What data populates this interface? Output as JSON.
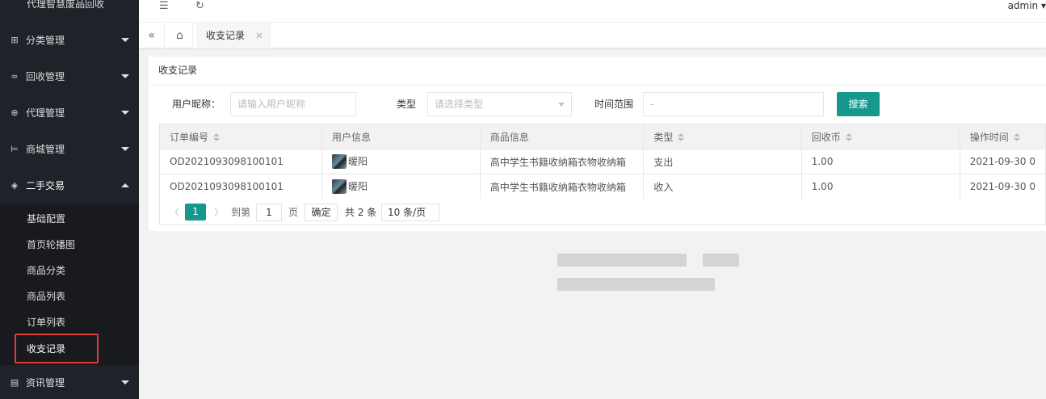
{
  "sidebar": {
    "top_partial": "代理智慧废品回收",
    "items": [
      {
        "label": "分类管理",
        "icon": "category-icon",
        "glyph": "⊞"
      },
      {
        "label": "回收管理",
        "icon": "link-icon",
        "glyph": "∞"
      },
      {
        "label": "代理管理",
        "icon": "add-circle-icon",
        "glyph": "⊕"
      },
      {
        "label": "商城管理",
        "icon": "cart-icon",
        "glyph": "⊨"
      },
      {
        "label": "二手交易",
        "icon": "cube-icon",
        "glyph": "◈"
      },
      {
        "label": "资讯管理",
        "icon": "news-icon",
        "glyph": "▤"
      }
    ],
    "sub_items": [
      "基础配置",
      "首页轮播图",
      "商品分类",
      "商品列表",
      "订单列表",
      "收支记录"
    ],
    "active_sub": "收支记录"
  },
  "header": {
    "menu_icon": "☰",
    "refresh_icon": "↻",
    "user": "admin ▾"
  },
  "tabs": {
    "collapse_glyph": "«",
    "home_glyph": "⌂",
    "active_label": "收支记录",
    "close_glyph": "×"
  },
  "card": {
    "title": "收支记录",
    "filters": {
      "nickname_label": "用户昵称：",
      "nickname_placeholder": "请输入用户昵称",
      "type_label": "类型",
      "type_placeholder": "请选择类型",
      "time_label": "时间范围",
      "time_placeholder": "-",
      "search_label": "搜索"
    },
    "table": {
      "columns": [
        "订单编号",
        "用户信息",
        "商品信息",
        "类型",
        "回收币",
        "操作时间"
      ],
      "rows": [
        {
          "order": "OD2021093098100101",
          "user": "暖阳",
          "product": "高中学生书籍收纳箱衣物收纳箱",
          "type": "支出",
          "coins": "1.00",
          "time": "2021-09-30 0"
        },
        {
          "order": "OD2021093098100101",
          "user": "暖阳",
          "product": "高中学生书籍收纳箱衣物收纳箱",
          "type": "收入",
          "coins": "1.00",
          "time": "2021-09-30 0"
        }
      ]
    },
    "pagination": {
      "prev": "〈",
      "current": "1",
      "next": "〉",
      "goto_label": "到第",
      "page_value": "1",
      "page_unit": "页",
      "confirm": "确定",
      "total": "共 2 条",
      "page_size": "10 条/页"
    }
  },
  "colors": {
    "sidebar_bg": "#20222a",
    "accent": "#16998c",
    "highlight_box": "#e53935"
  }
}
